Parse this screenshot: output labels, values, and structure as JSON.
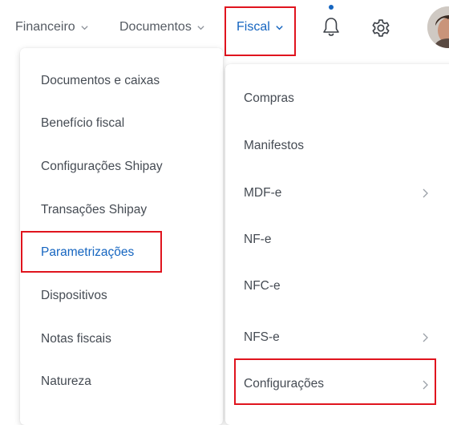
{
  "topnav": {
    "financeiro_label": "Financeiro",
    "documentos_label": "Documentos",
    "fiscal_label": "Fiscal"
  },
  "fiscal_menu": {
    "left_items": [
      {
        "label": "Documentos e caixas"
      },
      {
        "label": "Benefício fiscal"
      },
      {
        "label": "Configurações Shipay"
      },
      {
        "label": "Transações Shipay"
      },
      {
        "label": "Parametrizações",
        "active": true
      },
      {
        "label": "Dispositivos"
      },
      {
        "label": "Notas fiscais"
      },
      {
        "label": "Natureza"
      }
    ],
    "right_items": [
      {
        "label": "Compras",
        "has_submenu": false
      },
      {
        "label": "Manifestos",
        "has_submenu": false
      },
      {
        "label": "MDF-e",
        "has_submenu": true
      },
      {
        "label": "NF-e",
        "has_submenu": false
      },
      {
        "label": "NFC-e",
        "has_submenu": false
      },
      {
        "label": "NFS-e",
        "has_submenu": true
      },
      {
        "label": "Configurações",
        "has_submenu": true
      }
    ]
  },
  "icons": {
    "notification": "bell-icon",
    "settings": "gear-icon",
    "submenu": "chevron-right-icon",
    "dropdown": "chevron-down-icon"
  },
  "colors": {
    "accent": "#1565c0",
    "highlight_box": "#e0141e",
    "text": "#454b53"
  }
}
